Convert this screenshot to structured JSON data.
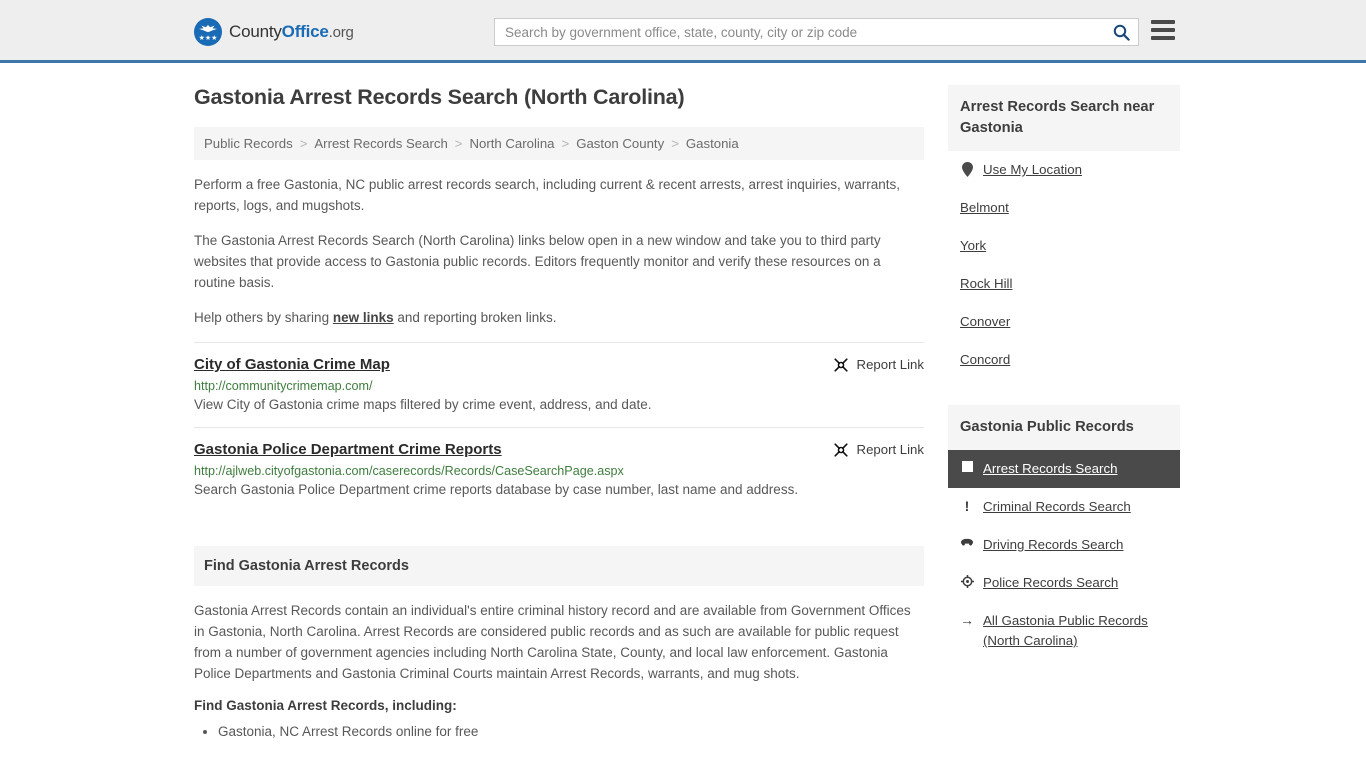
{
  "header": {
    "brand": {
      "part1": "County",
      "part2": "Office",
      "suffix": ".org",
      "logo_icon": "eagle-shield-icon",
      "stars": "★★★"
    },
    "search": {
      "placeholder": "Search by government office, state, county, city or zip code",
      "value": "",
      "icon": "search-icon"
    },
    "menu_icon": "hamburger-menu-icon"
  },
  "page": {
    "title": "Gastonia Arrest Records Search (North Carolina)"
  },
  "breadcrumb": {
    "separator": ">",
    "items": [
      {
        "label": "Public Records"
      },
      {
        "label": "Arrest Records Search"
      },
      {
        "label": "North Carolina"
      },
      {
        "label": "Gaston County"
      },
      {
        "label": "Gastonia"
      }
    ]
  },
  "intro": {
    "p1": "Perform a free Gastonia, NC public arrest records search, including current & recent arrests, arrest inquiries, warrants, reports, logs, and mugshots.",
    "p2": "The Gastonia Arrest Records Search (North Carolina) links below open in a new window and take you to third party websites that provide access to Gastonia public records. Editors frequently monitor and verify these resources on a routine basis.",
    "p3_before": "Help others by sharing ",
    "p3_link": "new links",
    "p3_after": " and reporting broken links."
  },
  "links": {
    "report_label": "Report Link",
    "report_icon": "broken-link-icon",
    "entries": [
      {
        "title": "City of Gastonia Crime Map",
        "url": "http://communitycrimemap.com/",
        "description": "View City of Gastonia crime maps filtered by crime event, address, and date."
      },
      {
        "title": "Gastonia Police Department Crime Reports",
        "url": "http://ajlweb.cityofgastonia.com/caserecords/Records/CaseSearchPage.aspx",
        "description": "Search Gastonia Police Department crime reports database by case number, last name and address."
      }
    ]
  },
  "find_section": {
    "heading": "Find Gastonia Arrest Records",
    "body": "Gastonia Arrest Records contain an individual's entire criminal history record and are available from Government Offices in Gastonia, North Carolina. Arrest Records are considered public records and as such are available for public request from a number of government agencies including North Carolina State, County, and local law enforcement. Gastonia Police Departments and Gastonia Criminal Courts maintain Arrest Records, warrants, and mug shots.",
    "sub_heading": "Find Gastonia Arrest Records, including:",
    "bullets": [
      "Gastonia, NC Arrest Records online for free"
    ]
  },
  "sidebar": {
    "nearby": {
      "heading": "Arrest Records Search near Gastonia",
      "items": [
        {
          "label": "Use My Location",
          "icon": "map-pin-icon"
        },
        {
          "label": "Belmont",
          "icon": ""
        },
        {
          "label": "York",
          "icon": ""
        },
        {
          "label": "Rock Hill",
          "icon": ""
        },
        {
          "label": "Conover",
          "icon": ""
        },
        {
          "label": "Concord",
          "icon": ""
        }
      ]
    },
    "public_records": {
      "heading": "Gastonia Public Records",
      "items": [
        {
          "label": "Arrest Records Search",
          "icon": "fingerprint-card-icon",
          "active": true
        },
        {
          "label": "Criminal Records Search",
          "icon": "exclamation-icon",
          "active": false
        },
        {
          "label": "Driving Records Search",
          "icon": "car-icon",
          "active": false
        },
        {
          "label": "Police Records Search",
          "icon": "police-badge-icon",
          "active": false
        },
        {
          "label": "All Gastonia Public Records (North Carolina)",
          "icon": "arrow-right-icon",
          "active": false
        }
      ]
    }
  },
  "colors": {
    "header_bg": "#eeeeee",
    "header_border": "#3d76a8",
    "brand_blue": "#1a6bb5",
    "panel_bg": "#f5f5f5",
    "active_bg": "#4a4a4a",
    "url_green": "#3f7d3f",
    "text": "#585858"
  }
}
